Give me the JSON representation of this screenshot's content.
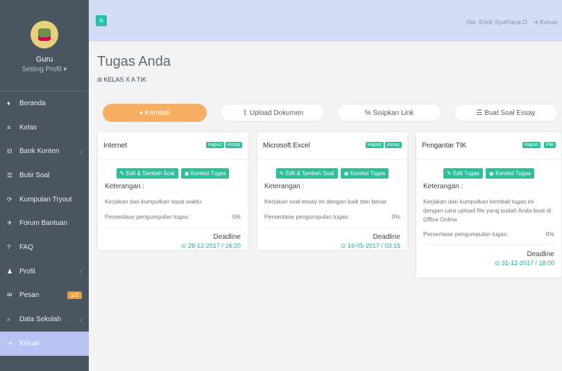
{
  "sidebar": {
    "user": {
      "name": "Guru",
      "setting": "Setting Profil ▾"
    },
    "items": [
      {
        "label": "Beranda",
        "icon": "home-icon",
        "glyph": "♦"
      },
      {
        "label": "Kelas",
        "icon": "class-icon",
        "glyph": "≡"
      },
      {
        "label": "Bank Konten",
        "icon": "bank-icon",
        "glyph": "⊟",
        "chevron": "‹"
      },
      {
        "label": "Butir Soal",
        "icon": "list-icon",
        "glyph": "☰"
      },
      {
        "label": "Kumpulan Tryout",
        "icon": "tryout-icon",
        "glyph": "⟳"
      },
      {
        "label": "Forum Bantuan",
        "icon": "forum-icon",
        "glyph": "✈"
      },
      {
        "label": "FAQ",
        "icon": "question-icon",
        "glyph": "?"
      },
      {
        "label": "Profil",
        "icon": "user-icon",
        "glyph": "♟",
        "chevron": "‹"
      },
      {
        "label": "Pesan",
        "icon": "message-icon",
        "glyph": "✉",
        "badge": "1/3"
      },
      {
        "label": "Data Sekolah",
        "icon": "search-icon",
        "glyph": "⌕",
        "chevron": "‹"
      },
      {
        "label": "Keluar",
        "icon": "logout-icon",
        "glyph": "⇥"
      }
    ]
  },
  "topbar": {
    "user_label": "Hai, Erick Syafriana D",
    "logout_label": "⇥  Keluar"
  },
  "header": {
    "title": "Tugas Anda",
    "subtitle": "di KELAS X A TIK"
  },
  "buttons": {
    "back": "♦ Kembali",
    "upload": "⇪ Upload Dokumen",
    "link": "% Sisipkan Link",
    "essay": "☰ Buat Soal Essay"
  },
  "cards": [
    {
      "title": "Internet",
      "tags": [
        "Hapus",
        "essay"
      ],
      "actions": [
        "✎ Edit & Tambah Soal",
        "◉ Koreksi Tugas"
      ],
      "ket_label": "Keterangan :",
      "desc": "Kerjakan dan kumpulkan tepat waktu",
      "percent_label": "Persentase pengumpulan tugas:",
      "percent_value": "0%",
      "deadline_label": "Deadline",
      "deadline_date": "⊙ 28-12-2017 / 16:20"
    },
    {
      "title": "Microsoft Excel",
      "tags": [
        "Hapus",
        "essay"
      ],
      "actions": [
        "✎ Edit & Tambah Soal",
        "◉ Koreksi Tugas"
      ],
      "ket_label": "Keterangan :",
      "desc": "Kerjakan soal essay ini dengan baik dan benar",
      "percent_label": "Persentase pengumpulan tugas:",
      "percent_value": "0%",
      "deadline_label": "Deadline",
      "deadline_date": "⊙ 16-05-2017 / 03:15"
    },
    {
      "title": "Pengantar TIK",
      "tags": [
        "Hapus",
        "File"
      ],
      "actions": [
        "✎ Edit Tugas",
        "◉ Koreksi Tugas"
      ],
      "ket_label": "Keterangan :",
      "desc": "Kerjakan dan kumpulkan kembali tugas ini dengan cara upload file yang sudah Anda buat di Office Online",
      "percent_label": "Persentase pengumpulan tugas:",
      "percent_value": "0%",
      "deadline_label": "Deadline",
      "deadline_date": "⊙ 31-12-2017 / 18:00"
    }
  ]
}
